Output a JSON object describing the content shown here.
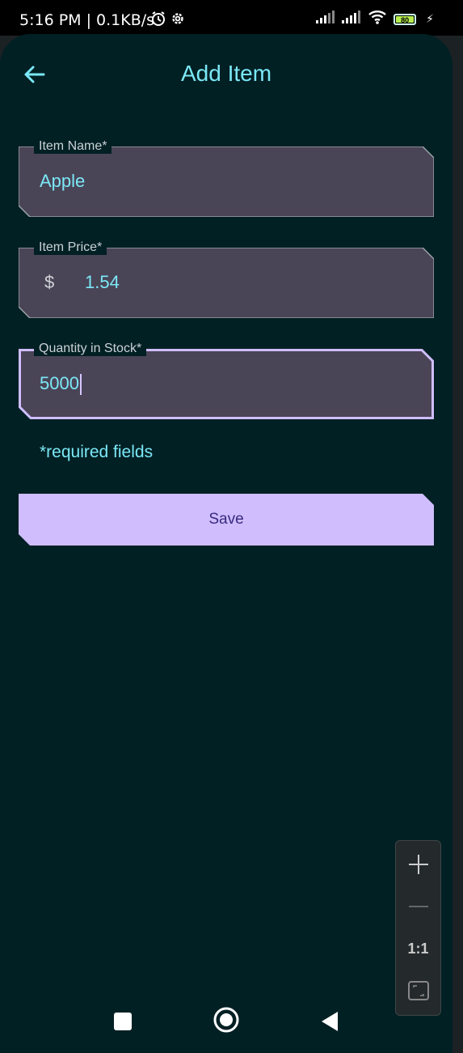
{
  "status_bar": {
    "time": "5:16 PM | 0.1KB/s",
    "icons": [
      "alarm-icon",
      "settings-gear-icon"
    ],
    "right_icons": [
      "signal-icon",
      "signal-icon",
      "wifi-icon",
      "battery-icon",
      "charging-icon"
    ],
    "battery": "80"
  },
  "appbar": {
    "back_icon": "arrow-left-icon",
    "title": "Add Item"
  },
  "form": {
    "item_name": {
      "label": "Item Name*",
      "value": "Apple"
    },
    "item_price": {
      "label": "Item Price*",
      "prefix": "$",
      "value": "1.54"
    },
    "quantity": {
      "label": "Quantity in Stock*",
      "value": "5000"
    },
    "required_note": "*required fields",
    "save_label": "Save"
  },
  "zoom_controls": {
    "items": [
      "zoom-in-icon",
      "zoom-out-icon",
      "actual-size",
      "fit-screen-icon"
    ],
    "actual_size_label": "1:1"
  },
  "nav_bar": {
    "items": [
      "recents-square-icon",
      "home-circle-icon",
      "back-triangle-icon"
    ]
  },
  "colors": {
    "background": "#012024",
    "accent": "#7be8f6",
    "field_fill": "#4a4457",
    "focused_border": "#cfbdfe",
    "button_fill": "#cfbdfe",
    "button_text": "#3a2a80"
  }
}
